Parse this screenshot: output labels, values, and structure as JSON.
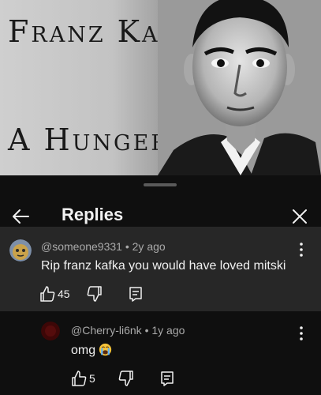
{
  "thumbnail": {
    "title_line1": "Franz Kafka",
    "title_line2": "A Hunger Artist"
  },
  "sheet": {
    "title": "Replies",
    "back_icon": "arrow-left-icon",
    "close_icon": "close-icon"
  },
  "parent_comment": {
    "author": "@someone9331",
    "time": "2y ago",
    "meta_sep": " • ",
    "text": "Rip franz kafka you would have loved mitski",
    "likes": "45",
    "avatar_color": "#c9a24a"
  },
  "reply": {
    "author": "@Cherry-li6nk",
    "time": "1y ago",
    "meta_sep": " • ",
    "text": "omg",
    "emoji": "loudly-crying-face",
    "likes": "5",
    "avatar_color": "#4a0a0a"
  },
  "colors": {
    "background": "#0f0f0f",
    "highlight": "#272727",
    "meta_text": "#aaaaaa",
    "text": "#f1f1f1"
  }
}
